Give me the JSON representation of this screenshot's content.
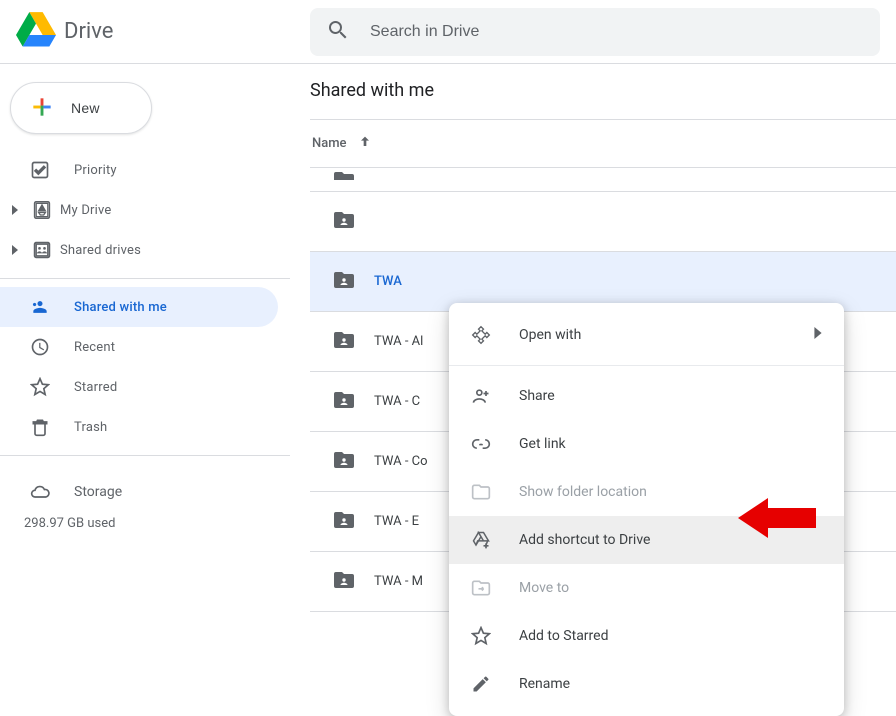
{
  "app": {
    "title": "Drive"
  },
  "search": {
    "placeholder": "Search in Drive"
  },
  "sidebar": {
    "new_label": "New",
    "items": [
      {
        "label": "Priority"
      },
      {
        "label": "My Drive"
      },
      {
        "label": "Shared drives"
      },
      {
        "label": "Shared with me"
      },
      {
        "label": "Recent"
      },
      {
        "label": "Starred"
      },
      {
        "label": "Trash"
      }
    ],
    "storage_label": "Storage",
    "storage_used": "298.97 GB used"
  },
  "content": {
    "title": "Shared with me",
    "column_name": "Name",
    "rows": [
      {
        "name": "TWA"
      },
      {
        "name": "TWA - Al"
      },
      {
        "name": "TWA - C"
      },
      {
        "name": "TWA - Co"
      },
      {
        "name": "TWA - E"
      },
      {
        "name": "TWA - M"
      }
    ]
  },
  "context_menu": {
    "open_with": "Open with",
    "share": "Share",
    "get_link": "Get link",
    "show_folder_location": "Show folder location",
    "add_shortcut": "Add shortcut to Drive",
    "move_to": "Move to",
    "add_to_starred": "Add to Starred",
    "rename": "Rename"
  }
}
